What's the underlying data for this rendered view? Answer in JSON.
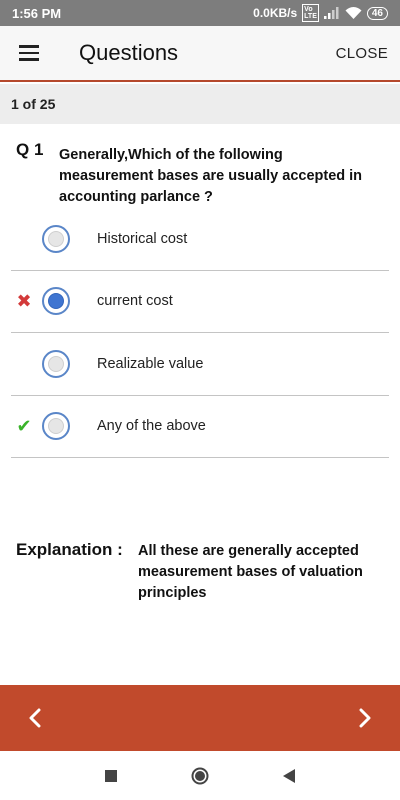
{
  "status_bar": {
    "time": "1:56 PM",
    "speed": "0.0KB/s",
    "sim_badge": "Vo LTE",
    "battery": "46"
  },
  "app_bar": {
    "title": "Questions",
    "close_label": "CLOSE",
    "menu_icon": "hamburger-menu-icon"
  },
  "progress": {
    "text": "1 of 25"
  },
  "question": {
    "number": "Q 1",
    "text": "Generally,Which of the following measurement bases are usually accepted in accounting parlance ?"
  },
  "options": [
    {
      "label": "Historical cost",
      "selected": false,
      "mark": ""
    },
    {
      "label": "current cost",
      "selected": true,
      "mark": "wrong"
    },
    {
      "label": "Realizable value",
      "selected": false,
      "mark": ""
    },
    {
      "label": "Any of the above",
      "selected": false,
      "mark": "right"
    }
  ],
  "marks": {
    "wrong_glyph": "✖",
    "right_glyph": "✔"
  },
  "explanation": {
    "title": "Explanation :",
    "text": "All these are generally accepted measurement bases of valuation principles"
  },
  "colors": {
    "accent": "#c14a2c",
    "radio_selected": "#3f75d1",
    "wrong": "#d33a3a",
    "right": "#3ab32a"
  },
  "nav": {
    "prev_icon": "chevron-left-icon",
    "next_icon": "chevron-right-icon"
  }
}
